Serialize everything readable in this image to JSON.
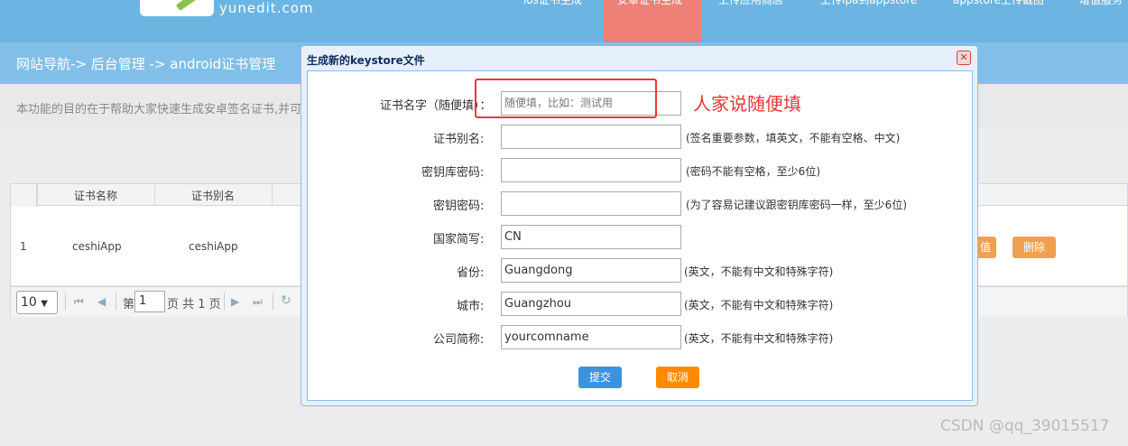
{
  "header": {
    "logo_text": "yunedit.com",
    "nav": [
      "ios证书生成",
      "安卓证书生成",
      "上传应用商店",
      "上传ipa到appstore",
      "appstore上传截图",
      "增值服务"
    ]
  },
  "breadcrumb": "网站导航-> 后台管理 -> android证书管理",
  "description": "本功能的目的在于帮助大家快速生成安卓签名证书,并可",
  "grid": {
    "columns": [
      "证书名称",
      "证书别名"
    ],
    "rows": [
      {
        "num": "1",
        "name": "ceshiApp",
        "alias": "ceshiApp"
      }
    ],
    "row_buttons": [
      "值",
      "删除"
    ],
    "pager": {
      "page_size": "10",
      "page_prefix": "第",
      "page_value": "1",
      "page_suffix": "页 共 1 页"
    }
  },
  "dialog": {
    "title": "生成新的keystore文件",
    "close_glyph": "✕",
    "fields": [
      {
        "label": "证书名字（随便填）：",
        "value": "",
        "placeholder": "随便填，比如：测试用",
        "hint": ""
      },
      {
        "label": "证书别名:",
        "value": "",
        "placeholder": "",
        "hint": "(签名重要参数，填英文，不能有空格、中文)"
      },
      {
        "label": "密钥库密码:",
        "value": "",
        "placeholder": "",
        "hint": "(密码不能有空格，至少6位)"
      },
      {
        "label": "密钥密码:",
        "value": "",
        "placeholder": "",
        "hint": "(为了容易记建议跟密钥库密码一样，至少6位)"
      },
      {
        "label": "国家简写:",
        "value": "CN",
        "placeholder": "",
        "hint": ""
      },
      {
        "label": "省份:",
        "value": "Guangdong",
        "placeholder": "",
        "hint": "(英文，不能有中文和特殊字符)"
      },
      {
        "label": "城市:",
        "value": "Guangzhou",
        "placeholder": "",
        "hint": "(英文，不能有中文和特殊字符)"
      },
      {
        "label": "公司简称:",
        "value": "yourcomname",
        "placeholder": "",
        "hint": "(英文，不能有中文和特殊字符)"
      }
    ],
    "submit_label": "提交",
    "cancel_label": "取消"
  },
  "annotation": "人家说随便填",
  "watermark": "CSDN @qq_39015517",
  "colors": {
    "header": "#6cb5e2",
    "active_nav": "#ef8078",
    "annotation": "#e53935",
    "submit": "#3d92e0",
    "cancel": "#ff8a00"
  }
}
